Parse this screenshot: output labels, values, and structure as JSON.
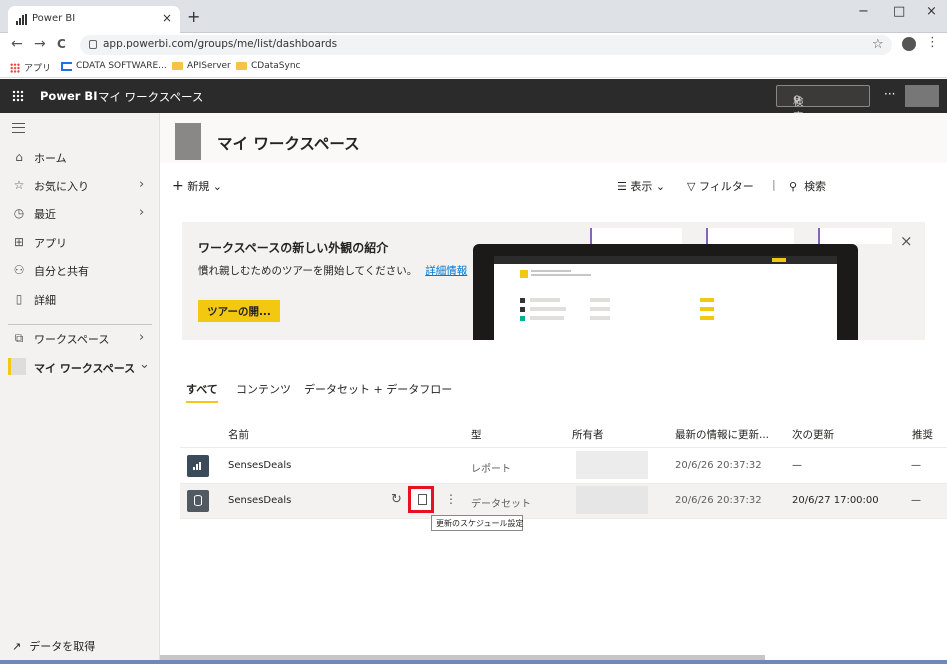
{
  "browser": {
    "tab_title": "Power BI",
    "tab_close": "×",
    "new_tab": "+",
    "window_minimize": "−",
    "window_maximize": "□",
    "window_close": "×",
    "back": "←",
    "forward": "→",
    "reload": "C",
    "url": "app.powerbi.com/groups/me/list/dashboards",
    "bookmark_star": "☆",
    "menu": "⋮",
    "bookmarks": [
      "アプリ",
      "CDATA SOFTWARE...",
      "APIServer",
      "CDataSync"
    ]
  },
  "header": {
    "brand": "Power BI",
    "breadcrumb": "マイ ワークスペース",
    "search_placeholder": "検索",
    "more": "···"
  },
  "sidebar": {
    "items": [
      {
        "icon": "⌂",
        "label": "ホーム",
        "chevron": ""
      },
      {
        "icon": "☆",
        "label": "お気に入り",
        "chevron": "›"
      },
      {
        "icon": "◷",
        "label": "最近",
        "chevron": "›"
      },
      {
        "icon": "⊞",
        "label": "アプリ",
        "chevron": ""
      },
      {
        "icon": "⚇",
        "label": "自分と共有",
        "chevron": ""
      },
      {
        "icon": "▯",
        "label": "詳細",
        "chevron": ""
      },
      {
        "icon": "⧉",
        "label": "ワークスペース",
        "chevron": "›"
      },
      {
        "icon": "",
        "label": "マイ ワークスペース",
        "chevron": "⌄"
      }
    ],
    "get_data_icon": "↗",
    "get_data": "データを取得"
  },
  "workspace": {
    "title": "マイ ワークスペース",
    "new_label": "新規",
    "view_label": "表示",
    "filter_label": "フィルター",
    "search_label": "検索"
  },
  "banner": {
    "title": "ワークスペースの新しい外観の紹介",
    "body": "慣れ親しむためのツアーを開始してください。",
    "link": "詳細情報",
    "button": "ツアーの開...",
    "close": "×"
  },
  "content_tabs": [
    "すべて",
    "コンテンツ",
    "データセット + データフロー"
  ],
  "table": {
    "headers": [
      "名前",
      "型",
      "所有者",
      "最新の情報に更新...",
      "次の更新",
      "推奨"
    ],
    "rows": [
      {
        "name": "SensesDeals",
        "type": "レポート",
        "last_refresh": "20/6/26 20:37:32",
        "next_refresh": "—",
        "endorsed": "—"
      },
      {
        "name": "SensesDeals",
        "type": "データセット",
        "last_refresh": "20/6/26 20:37:32",
        "next_refresh": "20/6/27 17:00:00",
        "endorsed": "—"
      }
    ],
    "refresh_icon": "↻",
    "more_icon": "⋮"
  },
  "tooltip": "更新のスケジュール設定",
  "colors": {
    "accent": "#f2c811",
    "header_bg": "#2b2b2b",
    "highlight": "#e81123",
    "link": "#0078d4"
  }
}
